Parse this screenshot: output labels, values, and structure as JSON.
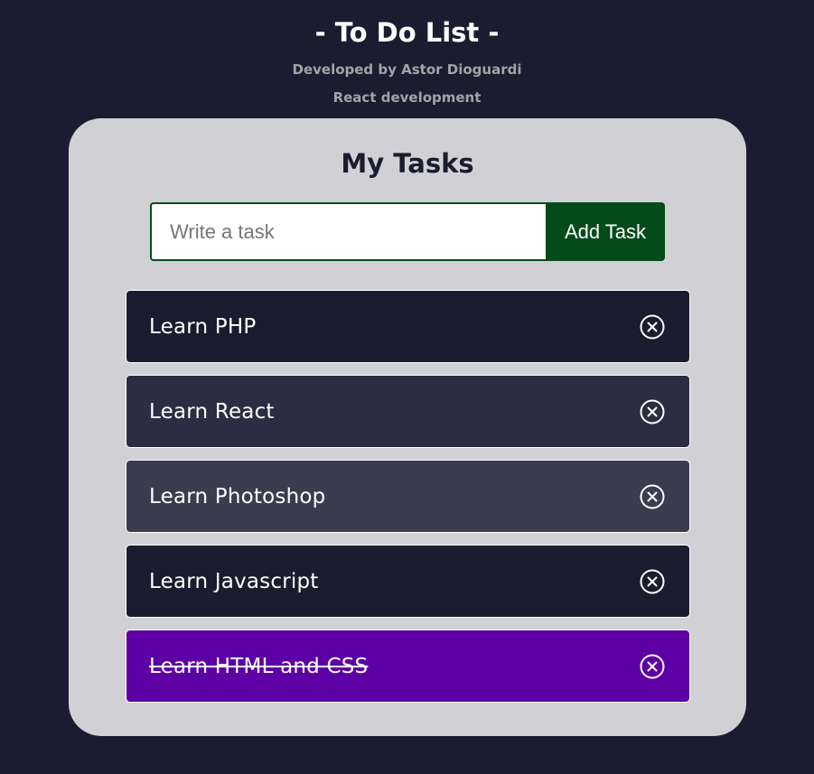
{
  "header": {
    "title": "- To Do List -",
    "developer": "Developed by Astor Dioguardi",
    "tagline": "React development"
  },
  "card": {
    "title": "My Tasks"
  },
  "form": {
    "placeholder": "Write a task",
    "value": "",
    "button_label": "Add Task"
  },
  "tasks": [
    {
      "text": "Learn PHP",
      "completed": false,
      "color": "#1c1c30",
      "icon": "close-circle-icon"
    },
    {
      "text": "Learn React",
      "completed": false,
      "color": "#2c2c43",
      "icon": "close-circle-icon"
    },
    {
      "text": "Learn Photoshop",
      "completed": false,
      "color": "#3c3c51",
      "icon": "close-circle-icon"
    },
    {
      "text": "Learn Javascript",
      "completed": false,
      "color": "#1c1c30",
      "icon": "close-circle-icon"
    },
    {
      "text": "Learn HTML and CSS",
      "completed": true,
      "color": "#5c00a6",
      "icon": "close-circle-icon"
    }
  ],
  "colors": {
    "background": "#1c1c30",
    "card": "#d1d1d5",
    "accent": "#044b1b",
    "completed": "#5c00a6"
  }
}
